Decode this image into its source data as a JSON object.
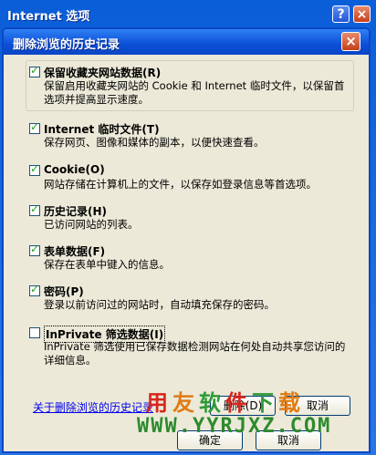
{
  "outer_window": {
    "title": "Internet 选项"
  },
  "dialog": {
    "title": "删除浏览的历史记录"
  },
  "options": [
    {
      "label": "保留收藏夹网站数据(R)",
      "description": "保留启用收藏夹网站的 Cookie 和 Internet 临时文件，以保留首选项并提高显示速度。",
      "checked": true
    },
    {
      "label": "Internet 临时文件(T)",
      "description": "保存网页、图像和媒体的副本，以便快速查看。",
      "checked": true
    },
    {
      "label": "Cookie(O)",
      "description": "网站存储在计算机上的文件，以保存如登录信息等首选项。",
      "checked": true
    },
    {
      "label": "历史记录(H)",
      "description": "已访问网站的列表。",
      "checked": true
    },
    {
      "label": "表单数据(F)",
      "description": "保存在表单中键入的信息。",
      "checked": true
    },
    {
      "label": "密码(P)",
      "description": "登录以前访问过的网站时，自动填充保存的密码。",
      "checked": true
    },
    {
      "label": "InPrivate 筛选数据(I)",
      "description": "InPrivate 筛选使用已保存数据检测网站在何处自动共享您访问的详细信息。",
      "checked": false
    }
  ],
  "footer": {
    "link": "关于删除浏览的历史记录",
    "delete_button": "删除(D)",
    "cancel_button": "取消",
    "ok_button": "确定",
    "cancel2_button": "取消"
  },
  "watermark": {
    "chars": [
      "用",
      "友",
      "软",
      "件",
      "下",
      "载"
    ],
    "url": "WWW.YYRJXZ.COM"
  },
  "colors": {
    "title_bar": "#0b4fd6",
    "dialog_bg": "#ece9d8",
    "link": "#0000ee",
    "checkmark": "#21a121"
  }
}
